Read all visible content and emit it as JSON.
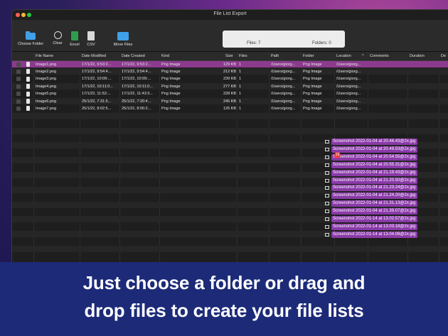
{
  "window": {
    "title": "File List Export"
  },
  "toolbar": {
    "choose_folder": "Choose Folder",
    "clear": "Clear",
    "excel": "Excel",
    "csv": "CSV",
    "move_files": "Move Files"
  },
  "status": {
    "files": "Files: 7",
    "folders": "Folders: 0"
  },
  "table": {
    "columns": [
      "File Name",
      "Date Modified",
      "Date Created",
      "Kind",
      "Size",
      "Files",
      "Path",
      "Folder",
      "Location",
      "Comments",
      "Duration",
      "De"
    ],
    "sort_indicator": "^",
    "rows": [
      {
        "name": "Image1.png",
        "modified": "17/1/22, 9:53:2...",
        "created": "17/1/22, 9:53:2...",
        "kind": "Png Image",
        "size": "129 KB",
        "files": "1",
        "path": "/Users/giorg...",
        "folder": "Png Image",
        "location": "/Users/giorg..."
      },
      {
        "name": "Image2.png",
        "modified": "17/1/22, 9:54:4...",
        "created": "17/1/22, 9:54:4...",
        "kind": "Png Image",
        "size": "212 KB",
        "files": "1",
        "path": "/Users/giorg...",
        "folder": "Png Image",
        "location": "/Users/giorg..."
      },
      {
        "name": "Image3.png",
        "modified": "17/1/22, 10:09:...",
        "created": "17/1/22, 10:09:...",
        "kind": "Png Image",
        "size": "239 KB",
        "files": "1",
        "path": "/Users/giorg...",
        "folder": "Png Image",
        "location": "/Users/giorg..."
      },
      {
        "name": "Image4.png",
        "modified": "17/1/22, 10:11:0...",
        "created": "17/1/22, 10:11:0...",
        "kind": "Png Image",
        "size": "277 KB",
        "files": "1",
        "path": "/Users/giorg...",
        "folder": "Png Image",
        "location": "/Users/giorg..."
      },
      {
        "name": "Image5.png",
        "modified": "17/1/22, 11:52:...",
        "created": "17/1/22, 11:43:3...",
        "kind": "Png Image",
        "size": "228 KB",
        "files": "1",
        "path": "/Users/giorg...",
        "folder": "Png Image",
        "location": "/Users/giorg..."
      },
      {
        "name": "Image6.png",
        "modified": "25/1/22, 7:31:5...",
        "created": "25/1/22, 7:20:4...",
        "kind": "Png Image",
        "size": "245 KB",
        "files": "1",
        "path": "/Users/giorg...",
        "folder": "Png Image",
        "location": "/Users/giorg..."
      },
      {
        "name": "Image7.png",
        "modified": "25/1/22, 8:02:5...",
        "created": "25/1/22, 8:00:2...",
        "kind": "Png Image",
        "size": "126 KB",
        "files": "1",
        "path": "/Users/giorg...",
        "folder": "Png Image",
        "location": "/Users/giorg..."
      }
    ]
  },
  "drag_items": [
    "Screenshot 2022-01-04 at 20.46.43@2x.jpg",
    "Screenshot 2022-01-04 at 20.49.53@2x.jpg",
    "Screenshot 2022-01-04 at 20.54.55@2x.jpg",
    "Screenshot 2022-01-04 at 20.55.31@2x.jpg",
    "Screenshot 2022-01-04 at 21.19.43@2x.jpg",
    "Screenshot 2022-01-04 at 21.20.50@2x.jpg",
    "Screenshot 2022-01-04 at 21.23.24@2x.jpg",
    "Screenshot 2022-01-04 at 21.24.20@2x.jpg",
    "Screenshot 2022-01-04 at 21.31.13@2x.jpg",
    "Screenshot 2022-01-04 at 21.39.07@2x.jpg",
    "Screenshot 2022-01-14 at 13.02.57@2x.jpg",
    "Screenshot 2022-01-14 at 13.03.18@2x.jpg",
    "Screenshot 2022-01-14 at 13.04.08@2x.jpg"
  ],
  "drag_badge": "13",
  "banner": {
    "line1": "Just choose a folder or drag and",
    "line2": "drop files to create your file lists"
  },
  "colors": {
    "selection": "#8c3a8e",
    "banner": "#1c2a78",
    "drag_label": "#8a3aa8"
  }
}
